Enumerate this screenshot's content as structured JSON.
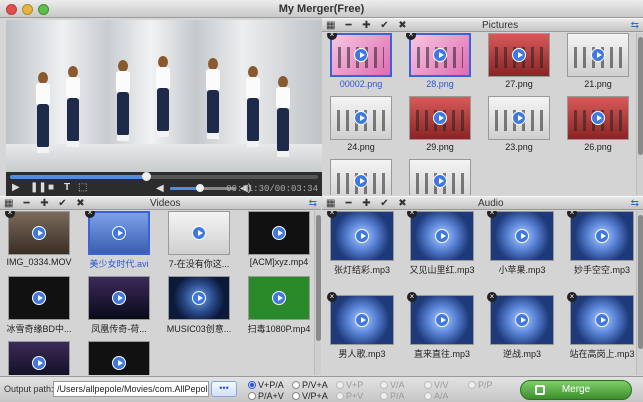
{
  "window": {
    "title": "My Merger(Free)"
  },
  "player": {
    "timecode": "00:01:30/00:03:34",
    "progress": 0.44,
    "volume": 0.45
  },
  "pictures": {
    "title": "Pictures",
    "items": [
      {
        "name": "00002.png",
        "selected": true,
        "art": "a-pink"
      },
      {
        "name": "28.png",
        "selected": true,
        "art": "a-pink"
      },
      {
        "name": "27.png",
        "selected": false,
        "art": "a-red"
      },
      {
        "name": "21.png",
        "selected": false,
        "art": "a-white"
      },
      {
        "name": "24.png",
        "selected": false,
        "art": "a-white"
      },
      {
        "name": "29.png",
        "selected": false,
        "art": "a-red"
      },
      {
        "name": "23.png",
        "selected": false,
        "art": "a-white"
      },
      {
        "name": "26.png",
        "selected": false,
        "art": "a-red"
      },
      {
        "name": "",
        "selected": false,
        "art": "a-white"
      },
      {
        "name": "",
        "selected": false,
        "art": "a-white"
      }
    ]
  },
  "videos": {
    "title": "Videos",
    "items": [
      {
        "name": "IMG_0334.MOV",
        "selected": false,
        "art": "a-room"
      },
      {
        "name": "美少女时代.avi",
        "selected": true,
        "art": "a-blue"
      },
      {
        "name": "7-在没有你这...",
        "selected": false,
        "art": "a-white"
      },
      {
        "name": "[ACM]xyz.mp4",
        "selected": false,
        "art": "a-dark"
      },
      {
        "name": "冰雪奇缘BD中...",
        "selected": false,
        "art": "a-dark"
      },
      {
        "name": "凤凰传奇-荷...",
        "selected": false,
        "art": "a-stage"
      },
      {
        "name": "MUSIC03创意...",
        "selected": false,
        "art": "a-music"
      },
      {
        "name": "扫毒1080P.mp4",
        "selected": false,
        "art": "a-green"
      },
      {
        "name": "",
        "selected": false,
        "art": "a-stage"
      },
      {
        "name": "",
        "selected": false,
        "art": "a-dark"
      }
    ]
  },
  "audio": {
    "title": "Audio",
    "items": [
      {
        "name": "张灯结彩.mp3"
      },
      {
        "name": "又见山里红.mp3"
      },
      {
        "name": "小苹果.mp3"
      },
      {
        "name": "妙手空空.mp3"
      },
      {
        "name": "男人歌.mp3"
      },
      {
        "name": "直来直往.mp3"
      },
      {
        "name": "逆战.mp3"
      },
      {
        "name": "站在高岗上.mp3"
      }
    ]
  },
  "toolbar_icons": [
    "grid-icon",
    "minus-icon",
    "add-icon",
    "check-icon",
    "close-icon"
  ],
  "output": {
    "label": "Output path:",
    "path": "/Users/allpepole/Movies/com.AllPepole",
    "browse": "•••"
  },
  "modes": [
    {
      "label": "V+P/A",
      "state": "on"
    },
    {
      "label": "P/V+A",
      "state": "off-enabled"
    },
    {
      "label": "V+P",
      "state": "disabled"
    },
    {
      "label": "V/A",
      "state": "disabled"
    },
    {
      "label": "V/V",
      "state": "disabled"
    },
    {
      "label": "P/P",
      "state": "disabled"
    },
    {
      "label": "P/A+V",
      "state": "off-enabled"
    },
    {
      "label": "V/P+A",
      "state": "off-enabled"
    },
    {
      "label": "P+V",
      "state": "disabled"
    },
    {
      "label": "P/A",
      "state": "disabled"
    },
    {
      "label": "A/A",
      "state": "disabled"
    }
  ],
  "merge": {
    "label": "Merge"
  },
  "colors": {
    "accent": "#2b57d6",
    "merge": "#4ea33a"
  }
}
